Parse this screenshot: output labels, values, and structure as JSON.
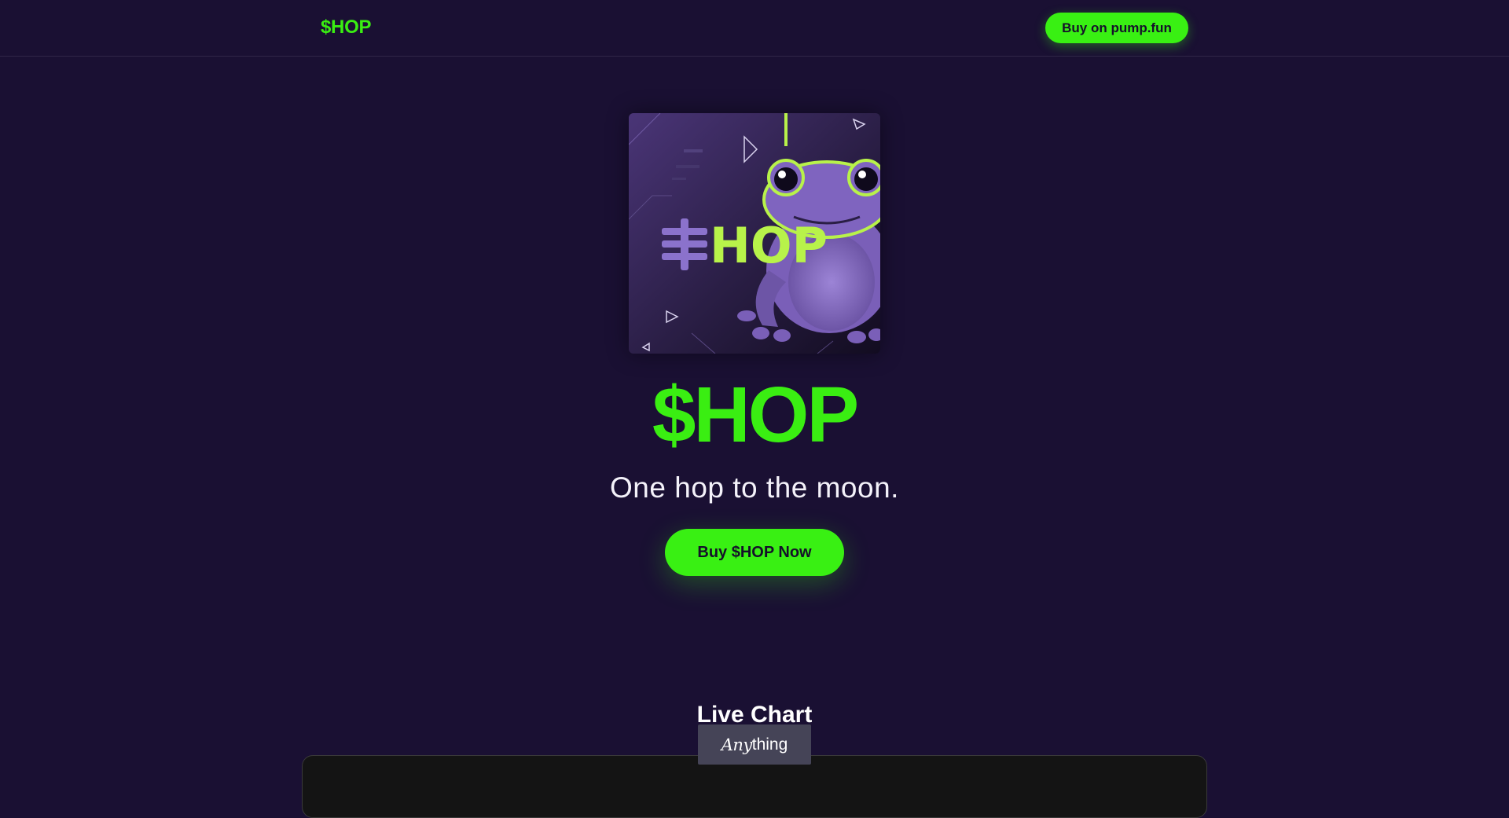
{
  "nav": {
    "brand": "$HOP",
    "buy_button": "Buy on pump.fun"
  },
  "hero": {
    "image_alt": "purple frog mascot with $HOP logo",
    "image_logo_text": "$HOP",
    "title": "$HOP",
    "tagline": "One hop to the moon.",
    "cta_label": "Buy $HOP Now"
  },
  "chart_section": {
    "title": "Live Chart"
  },
  "badge": {
    "prefix": "Any",
    "suffix": "thing"
  },
  "colors": {
    "background": "#1a1033",
    "accent": "#39f013",
    "frog_purple": "#7a5fb8",
    "logo_green": "#b8f24a"
  }
}
